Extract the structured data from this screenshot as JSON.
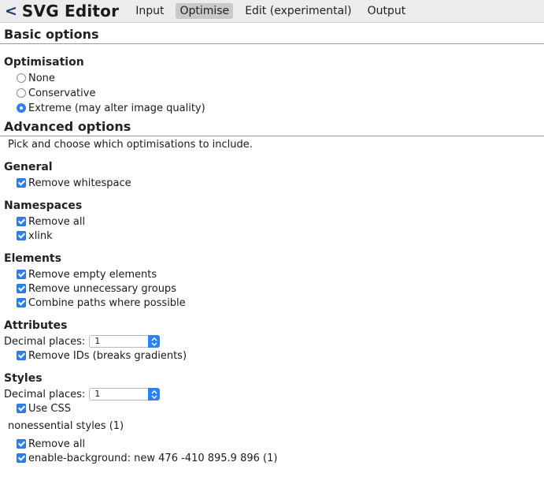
{
  "nav": {
    "back": "<",
    "title": "SVG Editor",
    "tabs": [
      {
        "label": "Input",
        "active": false
      },
      {
        "label": "Optimise",
        "active": true
      },
      {
        "label": "Edit (experimental)",
        "active": false
      },
      {
        "label": "Output",
        "active": false
      }
    ]
  },
  "basic": {
    "heading": "Basic options",
    "optimisation_heading": "Optimisation",
    "options": [
      {
        "label": "None",
        "checked": false
      },
      {
        "label": "Conservative",
        "checked": false
      },
      {
        "label": "Extreme (may alter image quality)",
        "checked": true
      }
    ]
  },
  "advanced": {
    "heading": "Advanced options",
    "description": "Pick and choose which optimisations to include.",
    "general": {
      "heading": "General",
      "items": [
        {
          "label": "Remove whitespace",
          "checked": true
        }
      ]
    },
    "namespaces": {
      "heading": "Namespaces",
      "items": [
        {
          "label": "Remove all",
          "checked": true
        },
        {
          "label": "xlink",
          "checked": true
        }
      ]
    },
    "elements": {
      "heading": "Elements",
      "items": [
        {
          "label": "Remove empty elements",
          "checked": true
        },
        {
          "label": "Remove unnecessary groups",
          "checked": true
        },
        {
          "label": "Combine paths where possible",
          "checked": true
        }
      ]
    },
    "attributes": {
      "heading": "Attributes",
      "decimal_label": "Decimal places:",
      "decimal_value": "1",
      "items": [
        {
          "label": "Remove IDs (breaks gradients)",
          "checked": true
        }
      ]
    },
    "styles": {
      "heading": "Styles",
      "decimal_label": "Decimal places:",
      "decimal_value": "1",
      "use_css": {
        "label": "Use CSS",
        "checked": true
      },
      "nonessential_label": "nonessential styles (1)",
      "items": [
        {
          "label": "Remove all",
          "checked": true
        },
        {
          "label": "enable-background: new 476 -410 895.9 896 (1)",
          "checked": true
        }
      ]
    }
  },
  "colors": {
    "accent": "#2f80e8",
    "nav_bg": "#ececec",
    "active_tab_bg": "#c9c9c9",
    "back_arrow": "#1f3b73"
  }
}
